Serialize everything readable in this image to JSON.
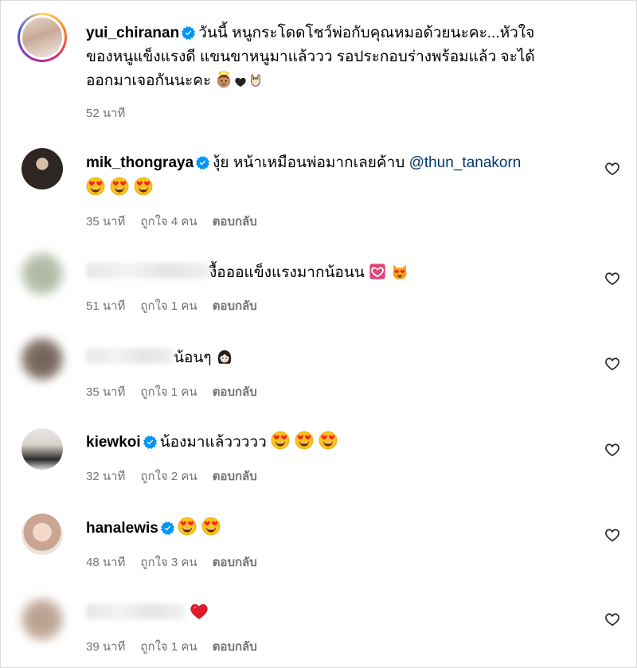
{
  "post": {
    "username": "yui_chiranan",
    "caption_lines": [
      "วันนี้ หนูกระโดดโชว์พ่อกับคุณหมอด้วยนะคะ...หัวใจ",
      "ของหนูแข็งแรงดี แขนขาหนูมาแล้ววว รอประกอบร่างพร้อมแล้ว จะได้",
      "ออกมาเจอกันนะคะ"
    ],
    "time": "52 นาที"
  },
  "labels": {
    "like_word": "ถูกใจ",
    "people_word": "คน",
    "reply": "ตอบกลับ"
  },
  "comments": [
    {
      "username": "mik_thongraya",
      "verified": true,
      "text": "งุ้ย หน้าเหมือนพ่อมากเลยค้าบ",
      "mention": "@thun_tanakorn",
      "time": "35 นาที",
      "likes": "4"
    },
    {
      "username": "",
      "verified": false,
      "text": "งื้อออแข็งแรงมากน้อนน",
      "time": "51 นาที",
      "likes": "1"
    },
    {
      "username": "",
      "verified": false,
      "text": "น้อนๆ",
      "time": "35 นาที",
      "likes": "1"
    },
    {
      "username": "kiewkoi",
      "verified": true,
      "text": "น้องมาแล้ววววว",
      "time": "32 นาที",
      "likes": "2"
    },
    {
      "username": "hanalewis",
      "verified": true,
      "text": "",
      "time": "48 นาที",
      "likes": "3"
    },
    {
      "username": "",
      "verified": false,
      "text": "",
      "time": "39 นาที",
      "likes": "1"
    }
  ],
  "colors": {
    "verified": "#0095f6",
    "mention": "#00376b",
    "meta": "#737373",
    "heart_red": "#ed4956"
  }
}
